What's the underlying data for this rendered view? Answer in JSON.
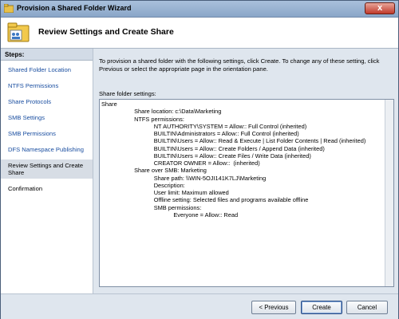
{
  "window": {
    "title": "Provision a Shared Folder Wizard",
    "close_glyph": "x"
  },
  "header": {
    "title": "Review Settings and Create Share",
    "icon": "shared-folder-icon"
  },
  "sidebar": {
    "heading": "Steps:",
    "items": [
      {
        "label": "Shared Folder Location",
        "state": "link"
      },
      {
        "label": "NTFS Permissions",
        "state": "link"
      },
      {
        "label": "Share Protocols",
        "state": "link"
      },
      {
        "label": "SMB Settings",
        "state": "link"
      },
      {
        "label": "SMB Permissions",
        "state": "link"
      },
      {
        "label": "DFS Namespace Publishing",
        "state": "link"
      },
      {
        "label": "Review Settings and Create Share",
        "state": "current"
      },
      {
        "label": "Confirmation",
        "state": "pending"
      }
    ]
  },
  "main": {
    "intro": "To provision a shared folder with the following settings, click Create. To change any of these setting, click Previous or select the appropriate page in the orientation pane.",
    "settings_label": "Share folder settings:",
    "settings_text": "Share\n                    Share location: c:\\Data\\Marketing\n                    NTFS permissions:\n                                NT AUTHORITY\\SYSTEM = Allow:: Full Control (inherited)\n                                BUILTIN\\Administrators = Allow:: Full Control (inherited)\n                                BUILTIN\\Users = Allow:: Read & Execute | List Folder Contents | Read (inherited)\n                                BUILTIN\\Users = Allow:: Create Folders / Append Data (inherited)\n                                BUILTIN\\Users = Allow:: Create Files / Write Data (inherited)\n                                CREATOR OWNER = Allow::  (inherited)\n                    Share over SMB: Marketing\n                                Share path: \\\\WIN-5OJI141K7LJ\\Marketing\n                                Description:\n                                User limit: Maximum allowed\n                                Offline setting: Selected files and programs available offline\n                                SMB permissions:\n                                            Everyone = Allow:: Read"
  },
  "footer": {
    "previous_label": "< Previous",
    "create_label": "Create",
    "cancel_label": "Cancel"
  },
  "colors": {
    "link": "#1a4ea0",
    "window_bg": "#dfe6ee",
    "titlebar": "#a9c0dc"
  }
}
